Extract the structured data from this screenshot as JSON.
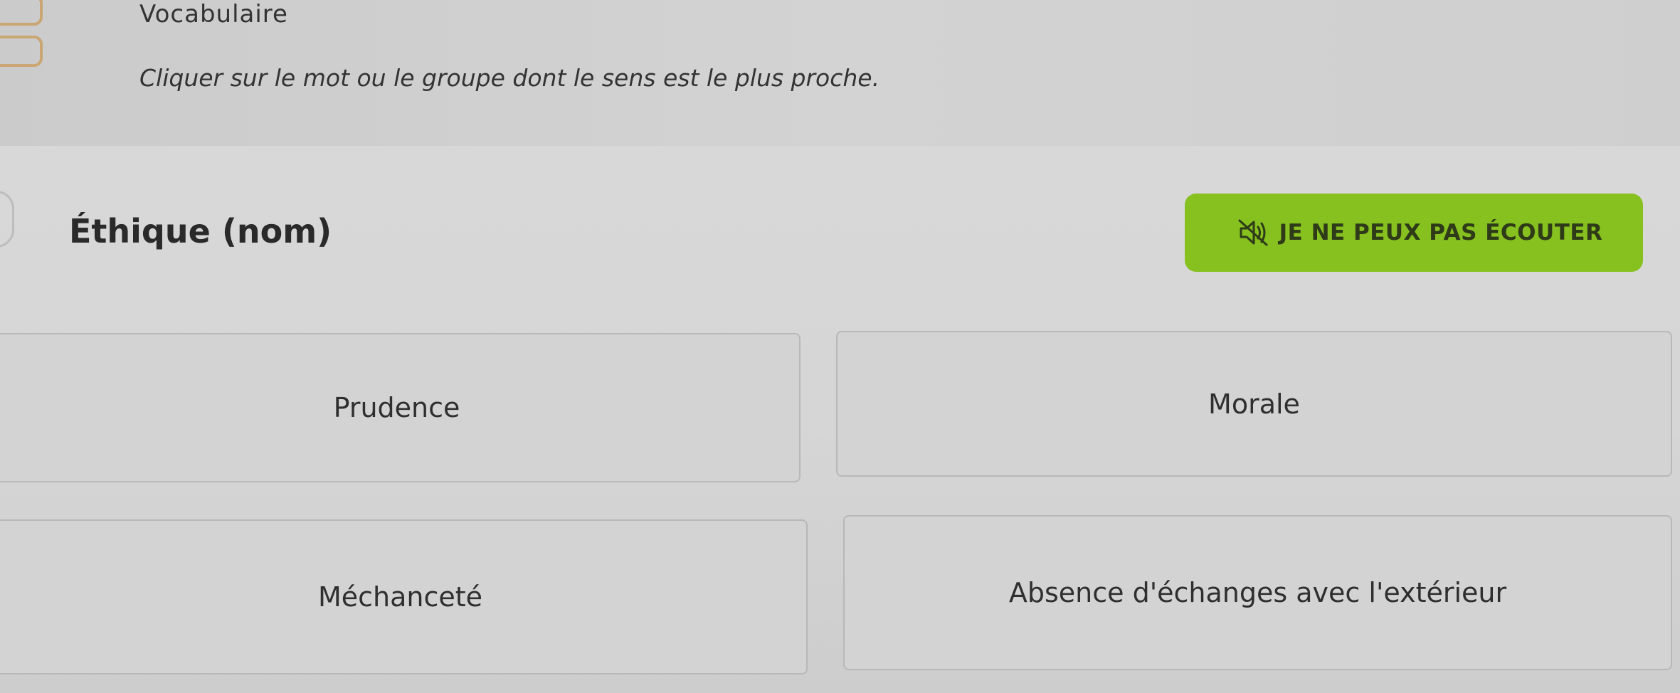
{
  "header": {
    "title": "Vocabulaire",
    "instruction": "Cliquer sur le mot ou le groupe dont le sens est le plus proche."
  },
  "question": {
    "word": "Éthique (nom)",
    "listen_button_label": "JE NE PEUX PAS ÉCOUTER",
    "listen_icon": "speaker-muted-icon"
  },
  "choices": [
    {
      "label": "Prudence"
    },
    {
      "label": "Morale"
    },
    {
      "label": "Méchanceté"
    },
    {
      "label": "Absence d'échanges avec l'extérieur"
    }
  ],
  "colors": {
    "accent_green": "#86c11f",
    "logo_tan": "#c9a672"
  }
}
